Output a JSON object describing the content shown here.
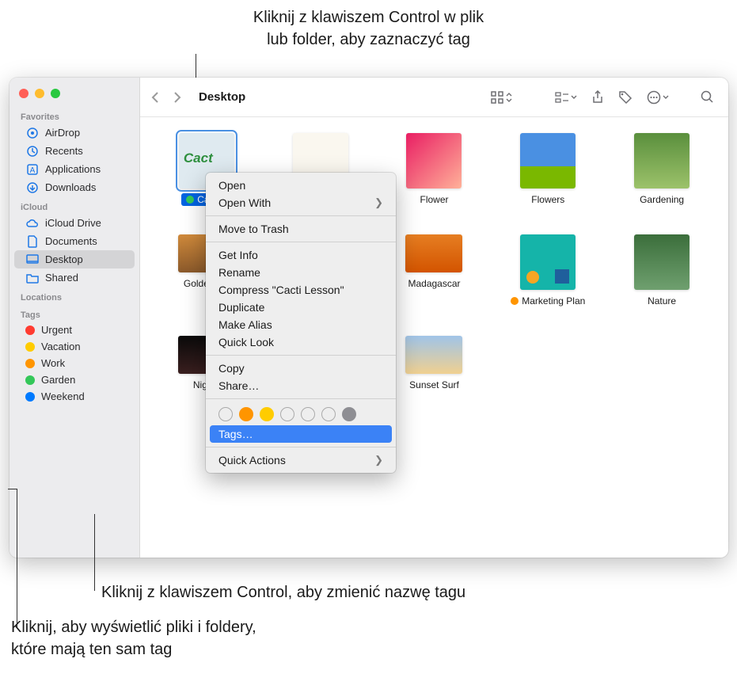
{
  "callouts": {
    "top_line1": "Kliknij z klawiszem Control w plik",
    "top_line2": "lub folder, aby zaznaczyć tag",
    "bottom1": "Kliknij z klawiszem Control, aby zmienić nazwę tagu",
    "bottom2_line1": "Kliknij, aby wyświetlić pliki i foldery,",
    "bottom2_line2": "które mają ten sam tag"
  },
  "toolbar": {
    "title": "Desktop"
  },
  "sidebar": {
    "sections": {
      "favorites": {
        "header": "Favorites",
        "items": [
          {
            "label": "AirDrop"
          },
          {
            "label": "Recents"
          },
          {
            "label": "Applications"
          },
          {
            "label": "Downloads"
          }
        ]
      },
      "icloud": {
        "header": "iCloud",
        "items": [
          {
            "label": "iCloud Drive"
          },
          {
            "label": "Documents"
          },
          {
            "label": "Desktop",
            "active": true
          },
          {
            "label": "Shared"
          }
        ]
      },
      "locations": {
        "header": "Locations"
      },
      "tags": {
        "header": "Tags",
        "items": [
          {
            "label": "Urgent",
            "color": "#ff3b30"
          },
          {
            "label": "Vacation",
            "color": "#ffcc00"
          },
          {
            "label": "Work",
            "color": "#ff9500"
          },
          {
            "label": "Garden",
            "color": "#34c759"
          },
          {
            "label": "Weekend",
            "color": "#007aff"
          }
        ]
      }
    }
  },
  "files": [
    {
      "label": "Cacti L",
      "selected": true,
      "tag_color": "#34c759",
      "thumb": "cacti"
    },
    {
      "label": "",
      "thumb": "district"
    },
    {
      "label": "Flower",
      "thumb": "flower"
    },
    {
      "label": "Flowers",
      "thumb": "flowers"
    },
    {
      "label": "Gardening",
      "thumb": "gardening"
    },
    {
      "label": "Golden Ga",
      "thumb": "golden"
    },
    {
      "label": "",
      "thumb": ""
    },
    {
      "label": "Madagascar",
      "thumb": "mada"
    },
    {
      "label": "Marketing Plan",
      "tag_color": "#ff9500",
      "thumb": "marketing"
    },
    {
      "label": "Nature",
      "thumb": "nature"
    },
    {
      "label": "Nightti",
      "thumb": "night"
    },
    {
      "label": "",
      "thumb": ""
    },
    {
      "label": "Sunset Surf",
      "thumb": "sunset"
    }
  ],
  "context_menu": {
    "items": [
      {
        "label": "Open"
      },
      {
        "label": "Open With",
        "submenu": true
      },
      {
        "sep": true
      },
      {
        "label": "Move to Trash"
      },
      {
        "sep": true
      },
      {
        "label": "Get Info"
      },
      {
        "label": "Rename"
      },
      {
        "label": "Compress \"Cacti Lesson\""
      },
      {
        "label": "Duplicate"
      },
      {
        "label": "Make Alias"
      },
      {
        "label": "Quick Look"
      },
      {
        "sep": true
      },
      {
        "label": "Copy"
      },
      {
        "label": "Share…"
      },
      {
        "sep": true
      },
      {
        "tagrow": true
      },
      {
        "label": "Tags…",
        "highlight": true
      },
      {
        "sep": true
      },
      {
        "label": "Quick Actions",
        "submenu": true
      }
    ],
    "tag_colors": [
      "transparent",
      "#ff9500",
      "#ffcc00",
      "transparent",
      "transparent",
      "transparent",
      "#8e8e93"
    ]
  }
}
